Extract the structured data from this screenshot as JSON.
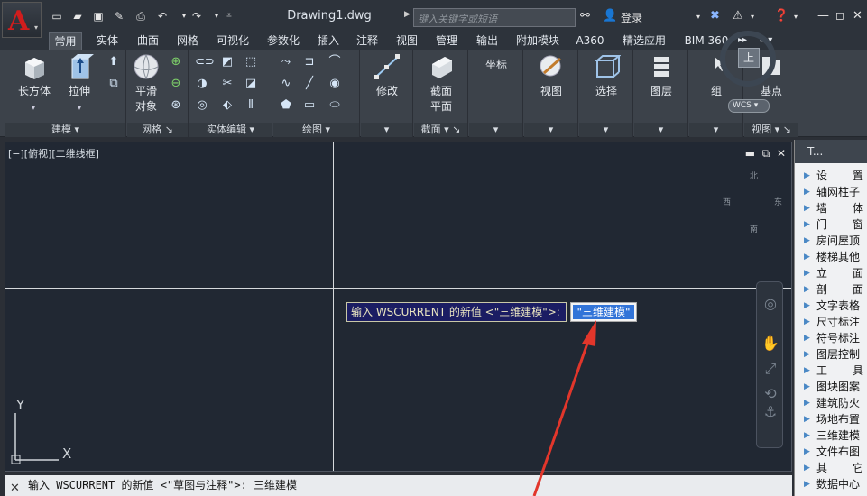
{
  "app": {
    "doc_title": "Drawing1.dwg",
    "search_placeholder": "键入关键字或短语",
    "login_label": "登录"
  },
  "tabs": [
    "常用",
    "实体",
    "曲面",
    "网格",
    "可视化",
    "参数化",
    "插入",
    "注释",
    "视图",
    "管理",
    "输出",
    "附加模块",
    "A360",
    "精选应用",
    "BIM 360"
  ],
  "active_tab": "常用",
  "panels": {
    "modeling": {
      "title": "建模",
      "box": "长方体",
      "extrude": "拉伸"
    },
    "mesh": {
      "title": "网格",
      "smooth": "平滑",
      "smooth2": "对象"
    },
    "solid_edit": {
      "title": "实体编辑"
    },
    "draw": {
      "title": "绘图"
    },
    "modify": {
      "label": "修改"
    },
    "section": {
      "title": "截面",
      "label1": "截面",
      "label2": "平面"
    },
    "coordinates": {
      "label": "坐标"
    },
    "view": {
      "label": "视图"
    },
    "selection": {
      "label": "选择"
    },
    "layers": {
      "label": "图层"
    },
    "groups": {
      "label": "组"
    },
    "viewpanel": {
      "title": "视图",
      "label": "基点"
    }
  },
  "viewport": {
    "label": "[−][俯视][二维线框]"
  },
  "viewcube": {
    "north": "北",
    "south": "南",
    "east": "东",
    "west": "西",
    "face": "上",
    "wcs": "WCS"
  },
  "dynamic_input": {
    "prompt": "输入 WSCURRENT 的新值 <\"三维建模\">:",
    "value": "\"三维建模\""
  },
  "ucs": {
    "x": "X",
    "y": "Y"
  },
  "command_line": {
    "text": "输入 WSCURRENT 的新值 <\"草图与注释\">: 三维建模"
  },
  "palette": {
    "title": "T...",
    "items": [
      "设　　置",
      "轴网柱子",
      "墙　　体",
      "门　　窗",
      "房间屋顶",
      "楼梯其他",
      "立　　面",
      "剖　　面",
      "文字表格",
      "尺寸标注",
      "符号标注",
      "图层控制",
      "工　　具",
      "图块图案",
      "建筑防火",
      "场地布置",
      "三维建模",
      "文件布图",
      "其　　它",
      "数据中心"
    ]
  }
}
